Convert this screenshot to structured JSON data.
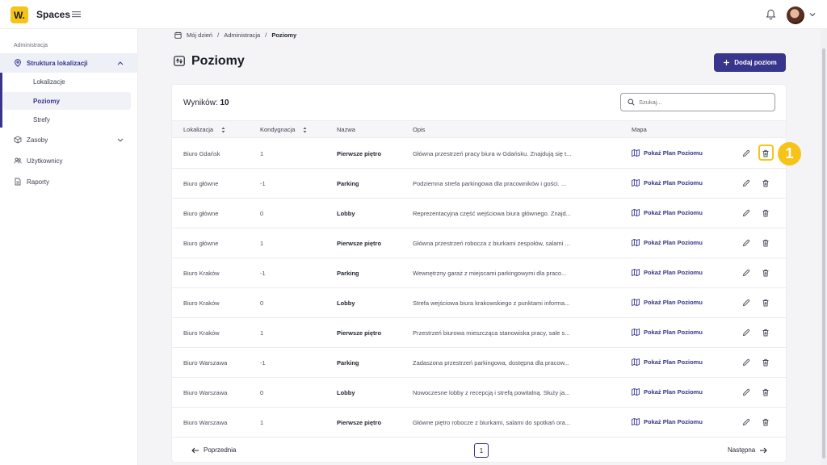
{
  "app": {
    "logo": "W.",
    "name": "Spaces"
  },
  "sidebar": {
    "section": "Administracja",
    "items": [
      {
        "label": "Struktura lokalizacji",
        "icon": "map-pin-icon"
      },
      {
        "label": "Zasoby",
        "icon": "cube-icon"
      },
      {
        "label": "Użytkownicy",
        "icon": "users-icon"
      },
      {
        "label": "Raporty",
        "icon": "report-icon"
      }
    ],
    "subitems": [
      {
        "label": "Lokalizacje"
      },
      {
        "label": "Poziomy"
      },
      {
        "label": "Strefy"
      }
    ]
  },
  "breadcrumb": {
    "home": "Mój dzień",
    "sep": "/",
    "mid": "Administracja",
    "current": "Poziomy"
  },
  "page": {
    "title": "Poziomy",
    "add_button": "Dodaj poziom"
  },
  "table": {
    "results_label": "Wyników:",
    "results_count": "10",
    "search_placeholder": "Szukaj...",
    "columns": [
      "Lokalizacja",
      "Kondygnacja",
      "Nazwa",
      "Opis",
      "Mapa"
    ],
    "map_link": "Pokaż Plan Poziomu",
    "rows": [
      {
        "loc": "Biuro Gdańsk",
        "floor": "1",
        "name": "Pierwsze piętro",
        "desc": "Główna przestrzeń pracy biura w Gdańsku. Znajdują się t..."
      },
      {
        "loc": "Biuro główne",
        "floor": "-1",
        "name": "Parking",
        "desc": "Podziemna strefa parkingowa dla pracowników i gości. ..."
      },
      {
        "loc": "Biuro główne",
        "floor": "0",
        "name": "Lobby",
        "desc": "Reprezentacyjna część wejściowa biura głównego. Znajd..."
      },
      {
        "loc": "Biuro główne",
        "floor": "1",
        "name": "Pierwsze piętro",
        "desc": "Główna przestrzeń robocza z biurkami zespołów, salami ..."
      },
      {
        "loc": "Biuro Kraków",
        "floor": "-1",
        "name": "Parking",
        "desc": "Wewnętrzny garaż z miejscami parkingowymi dla praco..."
      },
      {
        "loc": "Biuro Kraków",
        "floor": "0",
        "name": "Lobby",
        "desc": "Strefa wejściowa biura krakowskiego z punktami informa..."
      },
      {
        "loc": "Biuro Kraków",
        "floor": "1",
        "name": "Pierwsze piętro",
        "desc": "Przestrzeń biurowa mieszcząca stanowiska pracy, sale s..."
      },
      {
        "loc": "Biuro Warszawa",
        "floor": "-1",
        "name": "Parking",
        "desc": "Zadaszona przestrzeń parkingowa, dostępna dla pracow..."
      },
      {
        "loc": "Biuro Warszawa",
        "floor": "0",
        "name": "Lobby",
        "desc": "Nowoczesne lobby z recepcją i strefą powitalną. Służy ja..."
      },
      {
        "loc": "Biuro Warszawa",
        "floor": "1",
        "name": "Pierwsze piętro",
        "desc": "Główne piętro robocze z biurkami, salami do spotkań ora..."
      }
    ]
  },
  "pagination": {
    "prev": "Poprzednia",
    "page": "1",
    "next": "Następna"
  },
  "annotation": {
    "badge": "1"
  },
  "colors": {
    "accent": "#37358c",
    "brand_yellow": "#f6c419"
  }
}
